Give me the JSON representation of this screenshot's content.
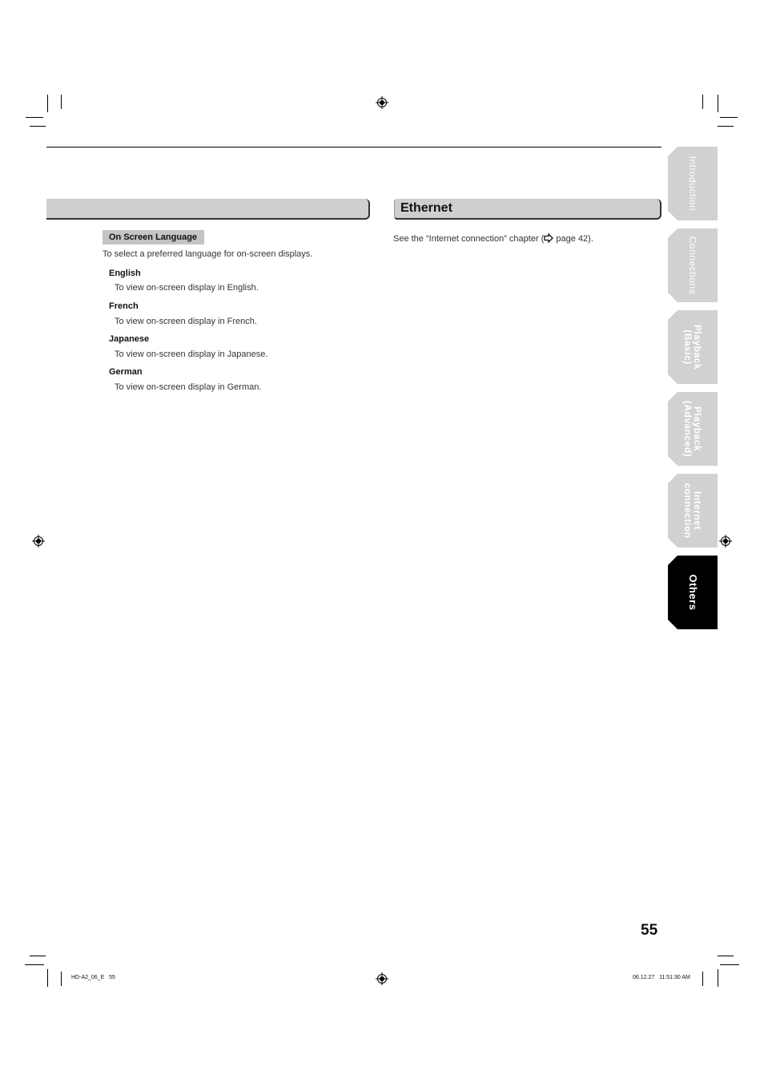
{
  "left_section": {
    "header_title": "",
    "subheading": "On Screen Language",
    "intro": "To select a preferred language for on-screen displays.",
    "options": [
      {
        "label": "English",
        "description": "To view on-screen display in English."
      },
      {
        "label": "French",
        "description": "To view on-screen display in French."
      },
      {
        "label": "Japanese",
        "description": "To view on-screen display in Japanese."
      },
      {
        "label": "German",
        "description": "To view on-screen display in German."
      }
    ]
  },
  "right_section": {
    "header_title": "Ethernet",
    "text_before": "See the “Internet connection” chapter (",
    "icon": "arrow-right-icon",
    "text_after": " page 42)."
  },
  "side_tabs": [
    {
      "label": "Introduction",
      "active": false
    },
    {
      "label": "Connections",
      "active": false
    },
    {
      "label": "Playback\n(Basic)",
      "active": false
    },
    {
      "label": "Playback\n(Advanced)",
      "active": false
    },
    {
      "label": "Internet\nconnection",
      "active": false
    },
    {
      "label": "Others",
      "active": true
    }
  ],
  "page_number": "55",
  "footer": {
    "left": "HD-A2_06_E   55",
    "right": "06.12.27   11:51:30 AM"
  },
  "colors": {
    "header_gray": "#cfcfcf",
    "tab_gray": "#d1d1d1",
    "tab_active": "#000000"
  }
}
